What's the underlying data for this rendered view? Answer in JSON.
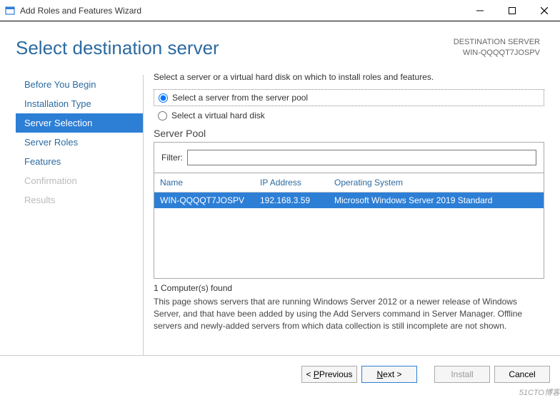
{
  "titlebar": {
    "title": "Add Roles and Features Wizard"
  },
  "header": {
    "page_title": "Select destination server",
    "dest_label_1": "DESTINATION SERVER",
    "dest_label_2": "WIN-QQQQT7JOSPV"
  },
  "nav": {
    "items": [
      {
        "label": "Before You Begin",
        "state": "normal"
      },
      {
        "label": "Installation Type",
        "state": "normal"
      },
      {
        "label": "Server Selection",
        "state": "active"
      },
      {
        "label": "Server Roles",
        "state": "normal"
      },
      {
        "label": "Features",
        "state": "normal"
      },
      {
        "label": "Confirmation",
        "state": "disabled"
      },
      {
        "label": "Results",
        "state": "disabled"
      }
    ]
  },
  "main": {
    "instruction": "Select a server or a virtual hard disk on which to install roles and features.",
    "radio_pool": "Select a server from the server pool",
    "radio_vhd": "Select a virtual hard disk",
    "pool_label": "Server Pool",
    "filter_label": "Filter:",
    "filter_value": "",
    "columns": {
      "name": "Name",
      "ip": "IP Address",
      "os": "Operating System"
    },
    "rows": [
      {
        "name": "WIN-QQQQT7JOSPV",
        "ip": "192.168.3.59",
        "os": "Microsoft Windows Server 2019 Standard",
        "selected": true
      }
    ],
    "found_label": "1 Computer(s) found",
    "note": "This page shows servers that are running Windows Server 2012 or a newer release of Windows Server, and that have been added by using the Add Servers command in Server Manager. Offline servers and newly-added servers from which data collection is still incomplete are not shown."
  },
  "footer": {
    "previous": "Previous",
    "next": "Next >",
    "install": "Install",
    "cancel": "Cancel"
  },
  "watermark": "51CTO博客"
}
